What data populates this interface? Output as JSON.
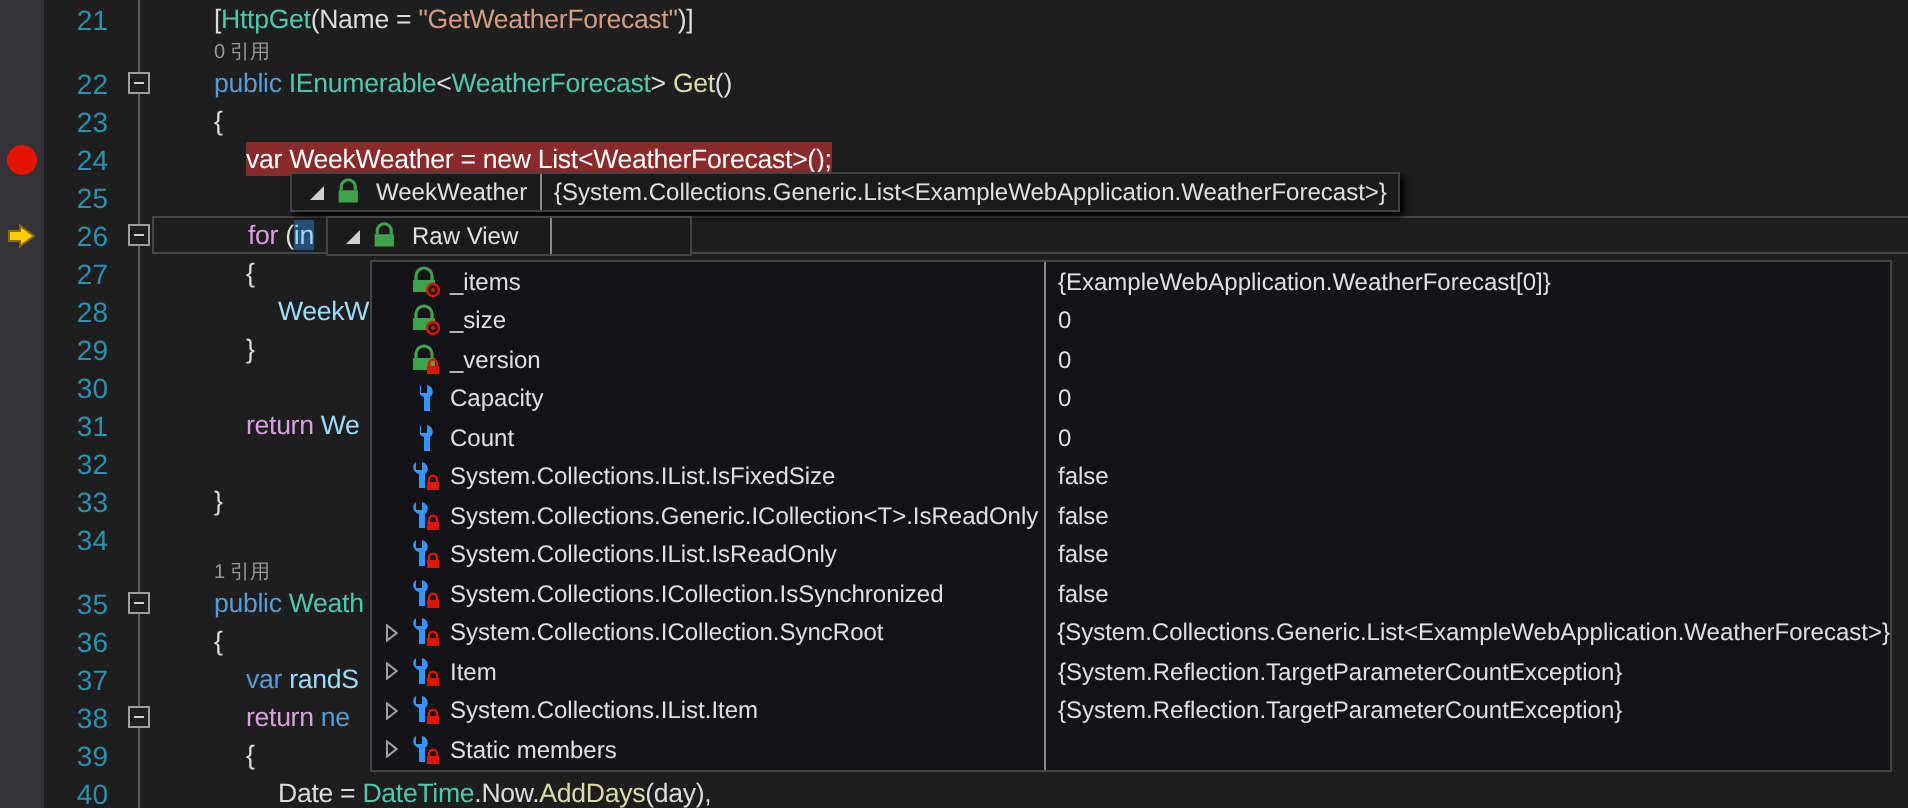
{
  "editor": {
    "lines": [
      {
        "number": "21",
        "breakpoint": false,
        "current": false,
        "foldable": false,
        "tokens": [
          {
            "text": "[",
            "kind": "plain"
          },
          {
            "text": "HttpGet",
            "kind": "type"
          },
          {
            "text": "(Name = ",
            "kind": "plain"
          },
          {
            "text": "\"GetWeatherForecast\"",
            "kind": "string"
          },
          {
            "text": ")]",
            "kind": "plain"
          }
        ]
      },
      {
        "codelens": "0 引用"
      },
      {
        "number": "22",
        "breakpoint": false,
        "current": false,
        "foldable": true,
        "tokens": [
          {
            "text": "public ",
            "kind": "keyword"
          },
          {
            "text": "IEnumerable",
            "kind": "type"
          },
          {
            "text": "<",
            "kind": "plain"
          },
          {
            "text": "WeatherForecast",
            "kind": "type"
          },
          {
            "text": "> ",
            "kind": "plain"
          },
          {
            "text": "Get",
            "kind": "method"
          },
          {
            "text": "()",
            "kind": "plain"
          }
        ]
      },
      {
        "number": "23",
        "breakpoint": false,
        "current": false,
        "foldable": false,
        "tokens": [
          {
            "text": "{",
            "kind": "plain"
          }
        ],
        "children": [
          {
            "number": "24",
            "breakpoint": true,
            "current": false,
            "foldable": false,
            "tokens": [
              {
                "text": "var WeekWeather = new List<WeatherForecast>();",
                "kind": "plain"
              }
            ]
          },
          {
            "number": "25",
            "breakpoint": false,
            "current": false,
            "foldable": false
          },
          {
            "number": "26",
            "breakpoint": false,
            "current": true,
            "foldable": true,
            "tokens": [
              {
                "text": "for",
                "kind": "control"
              },
              {
                "text": " (",
                "kind": "plain"
              },
              {
                "text": "in",
                "kind": "selected"
              }
            ]
          },
          {
            "number": "27",
            "breakpoint": false,
            "current": false,
            "foldable": false,
            "tokens": [
              {
                "text": "{",
                "kind": "plain"
              }
            ],
            "children": [
              {
                "number": "28",
                "breakpoint": false,
                "current": false,
                "foldable": false,
                "tokens": [
                  {
                    "text": "WeekW",
                    "kind": "variable"
                  }
                ]
              }
            ]
          },
          {
            "number": "29",
            "breakpoint": false,
            "current": false,
            "foldable": false,
            "tokens": [
              {
                "text": "}",
                "kind": "plain"
              }
            ]
          },
          {
            "number": "30",
            "breakpoint": false,
            "current": false,
            "foldable": false
          },
          {
            "number": "31",
            "breakpoint": false,
            "current": false,
            "foldable": false,
            "tokens": [
              {
                "text": "return ",
                "kind": "control"
              },
              {
                "text": "We",
                "kind": "variable"
              }
            ]
          },
          {
            "number": "32",
            "breakpoint": false,
            "current": false,
            "foldable": false
          }
        ]
      },
      {
        "number": "33",
        "breakpoint": false,
        "current": false,
        "foldable": false,
        "tokens": [
          {
            "text": "}",
            "kind": "plain"
          }
        ]
      },
      {
        "number": "34",
        "breakpoint": false,
        "current": false,
        "foldable": false
      },
      {
        "codelens": "1 引用"
      },
      {
        "number": "35",
        "breakpoint": false,
        "current": false,
        "foldable": true,
        "tokens": [
          {
            "text": "public ",
            "kind": "keyword"
          },
          {
            "text": "Weath",
            "kind": "type"
          }
        ]
      },
      {
        "number": "36",
        "breakpoint": false,
        "current": false,
        "foldable": false,
        "tokens": [
          {
            "text": "{",
            "kind": "plain"
          }
        ],
        "children": [
          {
            "number": "37",
            "breakpoint": false,
            "current": false,
            "foldable": false,
            "tokens": [
              {
                "text": "var ",
                "kind": "keyword"
              },
              {
                "text": "randS",
                "kind": "variable"
              }
            ]
          },
          {
            "number": "38",
            "breakpoint": false,
            "current": false,
            "foldable": true,
            "tokens": [
              {
                "text": "return ",
                "kind": "control"
              },
              {
                "text": "ne",
                "kind": "keyword"
              }
            ]
          },
          {
            "number": "39",
            "breakpoint": false,
            "current": false,
            "foldable": false,
            "tokens": [
              {
                "text": "{",
                "kind": "plain"
              }
            ],
            "children": [
              {
                "number": "40",
                "breakpoint": false,
                "current": false,
                "foldable": false,
                "tokens": [
                  {
                    "text": "Date = ",
                    "kind": "plain"
                  },
                  {
                    "text": "DateTime",
                    "kind": "type"
                  },
                  {
                    "text": ".Now.",
                    "kind": "plain"
                  },
                  {
                    "text": "AddDays",
                    "kind": "method"
                  },
                  {
                    "text": "(day),",
                    "kind": "plain"
                  }
                ]
              }
            ]
          }
        ]
      }
    ]
  },
  "datatip": {
    "rows": [
      {
        "name": "WeekWeather",
        "value": "{System.Collections.Generic.List<ExampleWebApplication.WeatherForecast>}",
        "expanded": true
      },
      {
        "name": "Raw View",
        "expanded": true
      }
    ],
    "members": [
      {
        "name": "_items",
        "value": "{ExampleWebApplication.WeatherForecast[0]}",
        "kind": "private-field",
        "expandable": false
      },
      {
        "name": "_size",
        "value": "0",
        "kind": "private-field",
        "expandable": false
      },
      {
        "name": "_version",
        "value": "0",
        "kind": "internal-field",
        "expandable": false
      },
      {
        "name": "Capacity",
        "value": "0",
        "kind": "property",
        "expandable": false
      },
      {
        "name": "Count",
        "value": "0",
        "kind": "property",
        "expandable": false
      },
      {
        "name": "System.Collections.IList.IsFixedSize",
        "value": "false",
        "kind": "private-property",
        "expandable": false
      },
      {
        "name": "System.Collections.Generic.ICollection<T>.IsReadOnly",
        "value": "false",
        "kind": "private-property",
        "expandable": false
      },
      {
        "name": "System.Collections.IList.IsReadOnly",
        "value": "false",
        "kind": "private-property",
        "expandable": false
      },
      {
        "name": "System.Collections.ICollection.IsSynchronized",
        "value": "false",
        "kind": "private-property",
        "expandable": false
      },
      {
        "name": "System.Collections.ICollection.SyncRoot",
        "value": "{System.Collections.Generic.List<ExampleWebApplication.WeatherForecast>}",
        "kind": "private-property",
        "expandable": true
      },
      {
        "name": "Item",
        "value": "{System.Reflection.TargetParameterCountException}",
        "kind": "private-property",
        "expandable": true
      },
      {
        "name": "System.Collections.IList.Item",
        "value": "{System.Reflection.TargetParameterCountException}",
        "kind": "private-property",
        "expandable": true
      },
      {
        "name": "Static members",
        "kind": "private-property",
        "expandable": true
      }
    ]
  }
}
